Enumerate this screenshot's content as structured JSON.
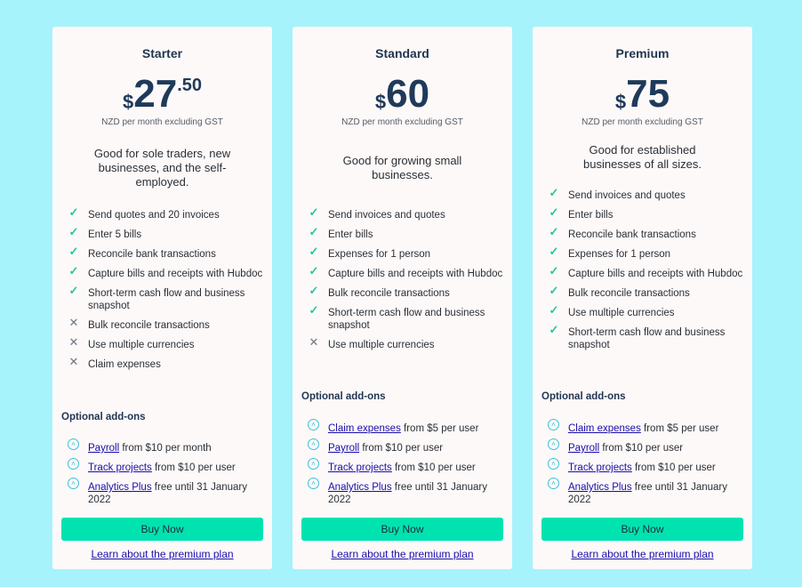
{
  "plans": [
    {
      "name": "Starter",
      "currency": "$",
      "price_main": "27",
      "price_cents": ".50",
      "price_note": "NZD per month excluding GST",
      "description": "Good for sole traders, new businesses, and the self-employed.",
      "features": [
        {
          "text": "Send quotes and 20 invoices",
          "included": true
        },
        {
          "text": "Enter 5 bills",
          "included": true
        },
        {
          "text": "Reconcile bank transactions",
          "included": true
        },
        {
          "text": "Capture bills and receipts with Hubdoc",
          "included": true
        },
        {
          "text": "Short-term cash flow and business snapshot",
          "included": true
        },
        {
          "text": "Bulk reconcile transactions",
          "included": false
        },
        {
          "text": "Use multiple currencies",
          "included": false
        },
        {
          "text": "Claim expenses",
          "included": false
        }
      ],
      "addons_title": "Optional add-ons",
      "addons": [
        {
          "link": "Payroll",
          "text": " from $10 per month"
        },
        {
          "link": "Track projects",
          "text": " from $10 per user"
        },
        {
          "link": "Analytics Plus",
          "text": " free until 31 January 2022"
        }
      ],
      "buy_label": "Buy Now",
      "learn_label": "Learn about the premium plan"
    },
    {
      "name": "Standard",
      "currency": "$",
      "price_main": "60",
      "price_cents": "",
      "price_note": "NZD per month excluding GST",
      "description": "Good for growing small businesses.",
      "features": [
        {
          "text": "Send invoices and quotes",
          "included": true
        },
        {
          "text": "Enter bills",
          "included": true
        },
        {
          "text": "Expenses for 1 person",
          "included": true
        },
        {
          "text": "Capture bills and receipts with Hubdoc",
          "included": true
        },
        {
          "text": "Bulk reconcile transactions",
          "included": true
        },
        {
          "text": "Short-term cash flow and business snapshot",
          "included": true
        },
        {
          "text": "Use multiple currencies",
          "included": false
        }
      ],
      "addons_title": "Optional add-ons",
      "addons": [
        {
          "link": "Claim expenses",
          "text": " from $5 per user"
        },
        {
          "link": "Payroll",
          "text": " from $10 per user"
        },
        {
          "link": "Track projects",
          "text": " from $10 per user"
        },
        {
          "link": "Analytics Plus",
          "text": " free until 31 January 2022"
        }
      ],
      "buy_label": "Buy Now",
      "learn_label": "Learn about the premium plan"
    },
    {
      "name": "Premium",
      "currency": "$",
      "price_main": "75",
      "price_cents": "",
      "price_note": "NZD per month excluding GST",
      "description": "Good for established businesses of all sizes.",
      "features": [
        {
          "text": "Send invoices and quotes",
          "included": true
        },
        {
          "text": "Enter bills",
          "included": true
        },
        {
          "text": "Reconcile bank transactions",
          "included": true
        },
        {
          "text": "Expenses for 1 person",
          "included": true
        },
        {
          "text": "Capture bills and receipts with Hubdoc",
          "included": true
        },
        {
          "text": "Bulk reconcile transactions",
          "included": true
        },
        {
          "text": "Use multiple currencies",
          "included": true
        },
        {
          "text": "Short-term cash flow and business snapshot",
          "included": true
        }
      ],
      "addons_title": "Optional add-ons",
      "addons": [
        {
          "link": "Claim expenses",
          "text": " from $5 per user"
        },
        {
          "link": "Payroll",
          "text": " from $10 per user"
        },
        {
          "link": "Track projects",
          "text": " from $10 per user"
        },
        {
          "link": "Analytics Plus",
          "text": " free until 31 January 2022"
        }
      ],
      "buy_label": "Buy Now",
      "learn_label": "Learn about the premium plan"
    }
  ],
  "icons": {
    "included": "check-icon",
    "excluded": "cross-icon",
    "addon": "chevron-up-circle-icon"
  },
  "colors": {
    "background": "#a6f3fb",
    "button": "#00e3b0",
    "check": "#1ec9a0",
    "link": "#1a0dab"
  }
}
